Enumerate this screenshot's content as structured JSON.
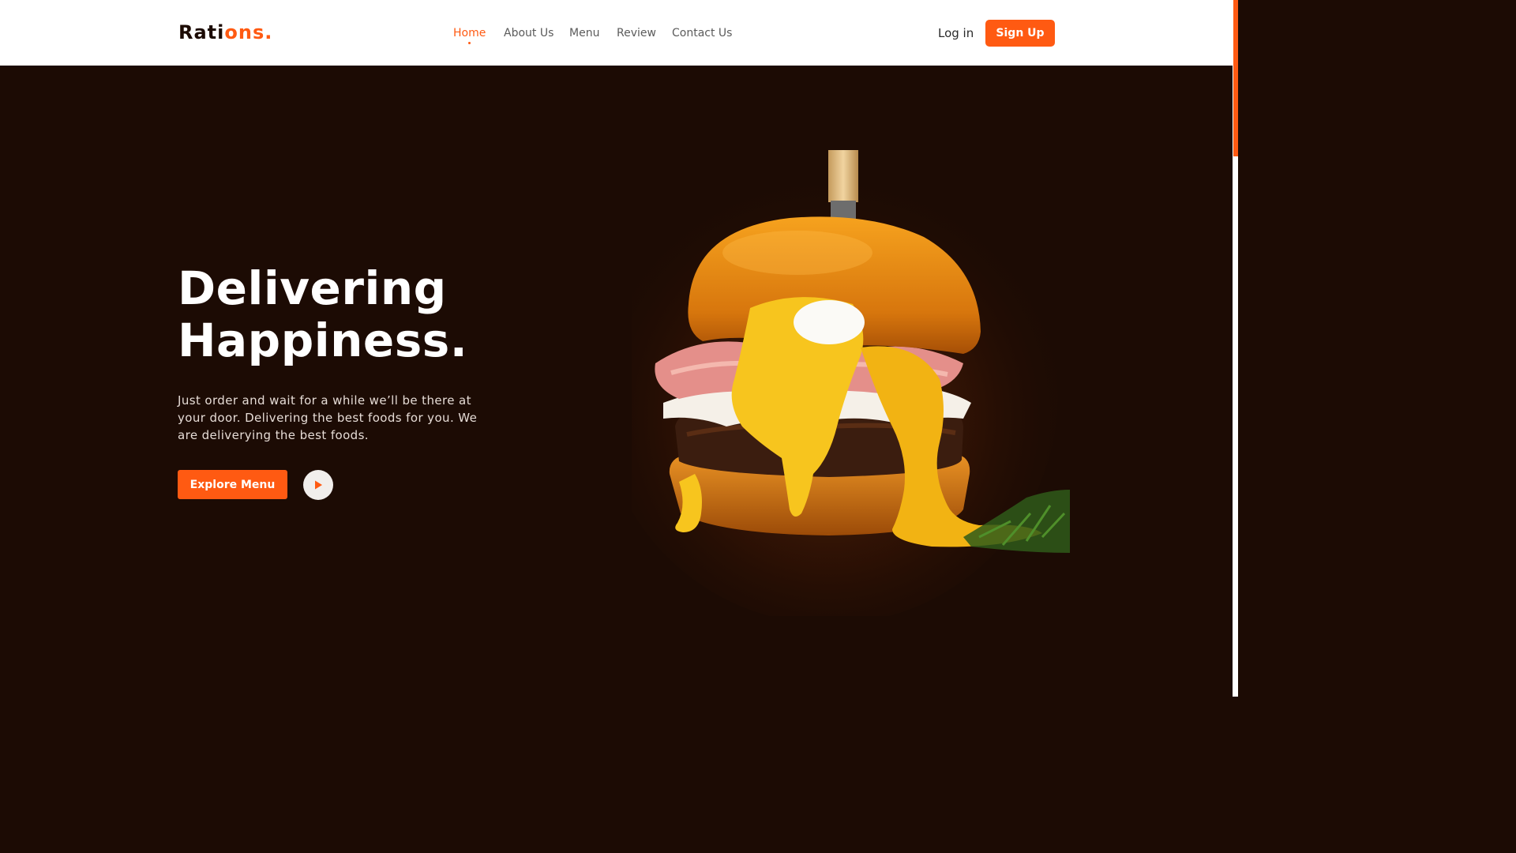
{
  "header": {
    "logo": {
      "main": "Rati",
      "accent": "ons."
    },
    "nav": [
      {
        "label": "Home",
        "active": true
      },
      {
        "label": "About Us",
        "active": false
      },
      {
        "label": "Menu",
        "active": false
      },
      {
        "label": "Review",
        "active": false
      },
      {
        "label": "Contact Us",
        "active": false
      }
    ],
    "login_label": "Log in",
    "signup_label": "Sign Up"
  },
  "hero": {
    "title_line1": "Delivering",
    "title_line2": "Happiness.",
    "description": "Just order and wait for a while we’ll be there at your door. Delivering the best foods for you. We are deliverying the best foods.",
    "explore_label": "Explore Menu"
  },
  "icons": {
    "play": "play-icon",
    "hero_image": "burger-image"
  },
  "colors": {
    "accent": "#ff5a12",
    "hero_background": "#1c0b04",
    "header_background": "#ffffff"
  }
}
